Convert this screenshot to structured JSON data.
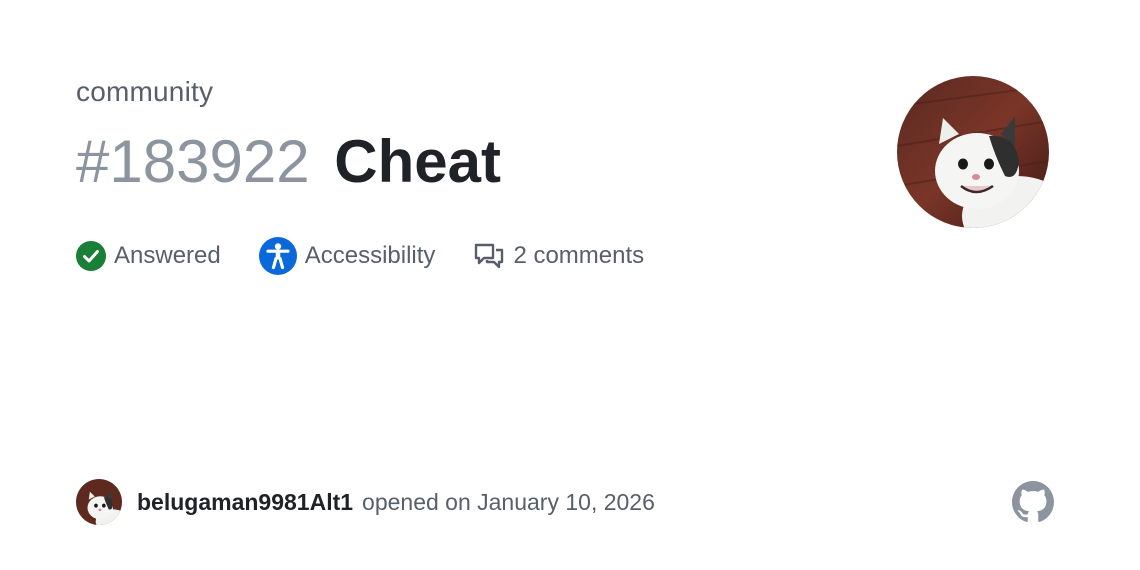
{
  "repo": "community",
  "issue": {
    "number": "#183922",
    "title": "Cheat"
  },
  "meta": {
    "status": "Answered",
    "category": "Accessibility",
    "comments": "2 comments"
  },
  "author": {
    "username": "belugaman9981Alt1",
    "opened_text": "opened on January 10, 2026"
  },
  "colors": {
    "answered_green": "#1a7f37",
    "accessibility_blue": "#0969da",
    "muted": "#57606a",
    "title": "#1f2328",
    "number": "#8c959f"
  },
  "icons": {
    "status": "check-circle-icon",
    "category": "accessibility-icon",
    "comments": "comment-discussion-icon",
    "brand": "github-logo-icon"
  }
}
